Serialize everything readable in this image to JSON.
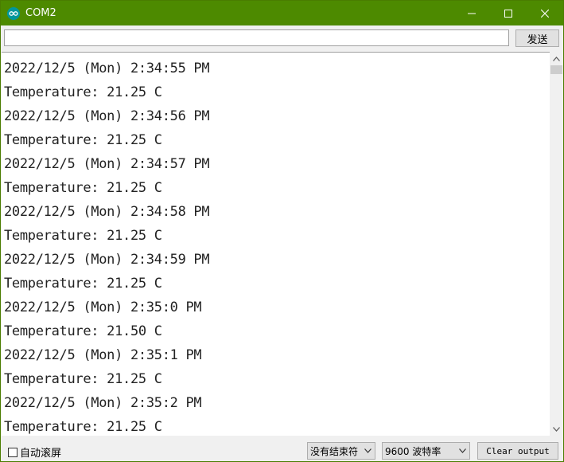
{
  "window": {
    "title": "COM2",
    "controls": {
      "minimize_icon": "minimize-icon",
      "maximize_icon": "maximize-icon",
      "close_icon": "close-icon"
    },
    "title_bar_color": "#4d8a00"
  },
  "send_bar": {
    "input_value": "",
    "send_label": "发送"
  },
  "output": {
    "lines": [
      "2022/12/5 (Mon) 2:34:55 PM",
      "Temperature: 21.25 C",
      "2022/12/5 (Mon) 2:34:56 PM",
      "Temperature: 21.25 C",
      "2022/12/5 (Mon) 2:34:57 PM",
      "Temperature: 21.25 C",
      "2022/12/5 (Mon) 2:34:58 PM",
      "Temperature: 21.25 C",
      "2022/12/5 (Mon) 2:34:59 PM",
      "Temperature: 21.25 C",
      "2022/12/5 (Mon) 2:35:0 PM",
      "Temperature: 21.50 C",
      "2022/12/5 (Mon) 2:35:1 PM",
      "Temperature: 21.25 C",
      "2022/12/5 (Mon) 2:35:2 PM",
      "Temperature: 21.25 C"
    ]
  },
  "bottom_bar": {
    "autoscroll_label": "自动滚屏",
    "autoscroll_checked": false,
    "line_ending_selected": "没有结束符",
    "baud_selected": "9600 波特率",
    "clear_label": "Clear output"
  }
}
